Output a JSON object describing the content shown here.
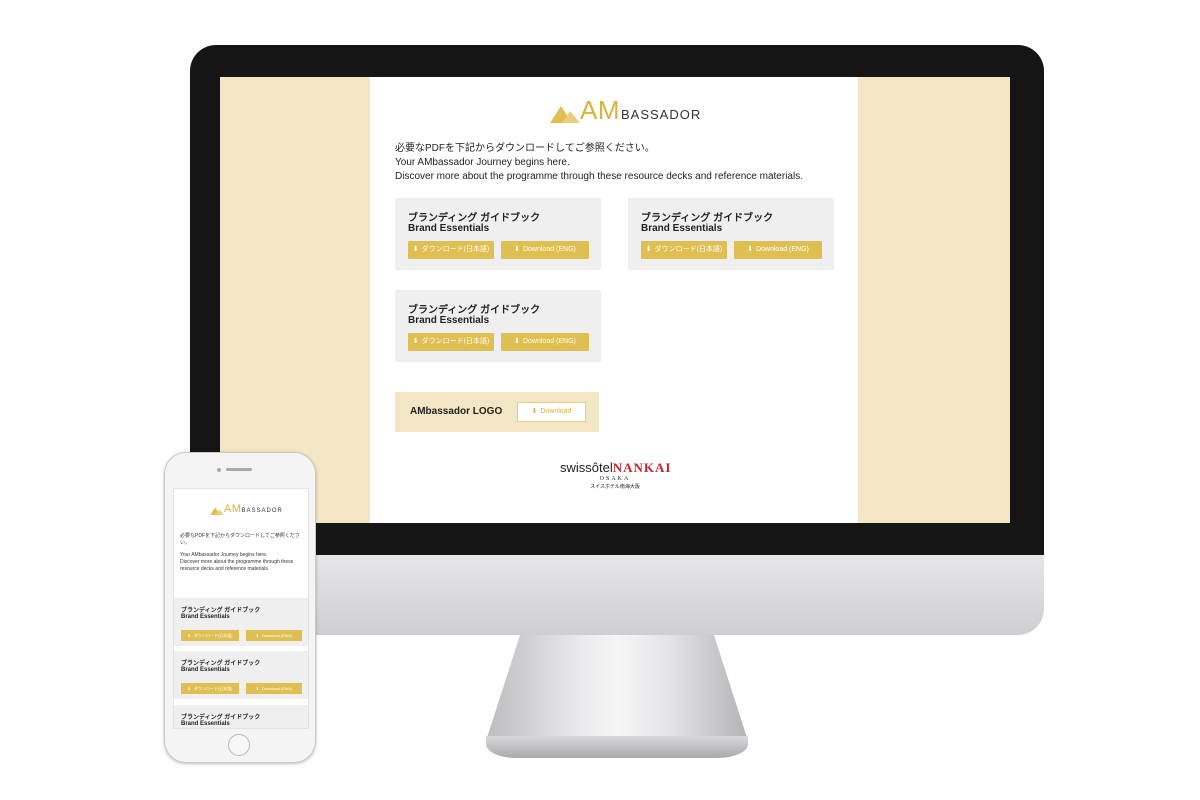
{
  "logo": {
    "am": "AM",
    "bassador": "BASSADOR"
  },
  "intro": {
    "line1": "必要なPDFを下記からダウンロードしてご参照ください。",
    "line2": "Your AMbassador Journey begins here.",
    "line3": "Discover more about the programme through these resource decks and reference materials."
  },
  "resources": [
    {
      "title_jp": "ブランディング ガイドブック",
      "title_en": "Brand Essentials",
      "btn_jp": "ダウンロード(日本語)",
      "btn_en": "Download (ENG)"
    },
    {
      "title_jp": "ブランディング ガイドブック",
      "title_en": "Brand Essentials",
      "btn_jp": "ダウンロード(日本語)",
      "btn_en": "Download (ENG)"
    },
    {
      "title_jp": "ブランディング ガイドブック",
      "title_en": "Brand Essentials",
      "btn_jp": "ダウンロード(日本語)",
      "btn_en": "Download (ENG)"
    }
  ],
  "logo_download": {
    "label": "AMbassador LOGO",
    "button": "Download"
  },
  "footer": {
    "swiss": "swissôtel",
    "nankai": "NANKAI",
    "city": "OSAKA",
    "jp": "スイスホテル南海大阪"
  },
  "mobile": {
    "intro_jp": "必要なPDFを下記からダウンロードしてご参照ください。",
    "intro_en1": "Your AMbassador Journey begins here.",
    "intro_en2": "Discover more about the programme through these resource decks and reference materials."
  },
  "icons": {
    "download": "download-icon"
  },
  "colors": {
    "gold": "#dfbe52",
    "cream": "#f3e6c4",
    "card": "#efefef",
    "nankai_red": "#c0272d"
  }
}
